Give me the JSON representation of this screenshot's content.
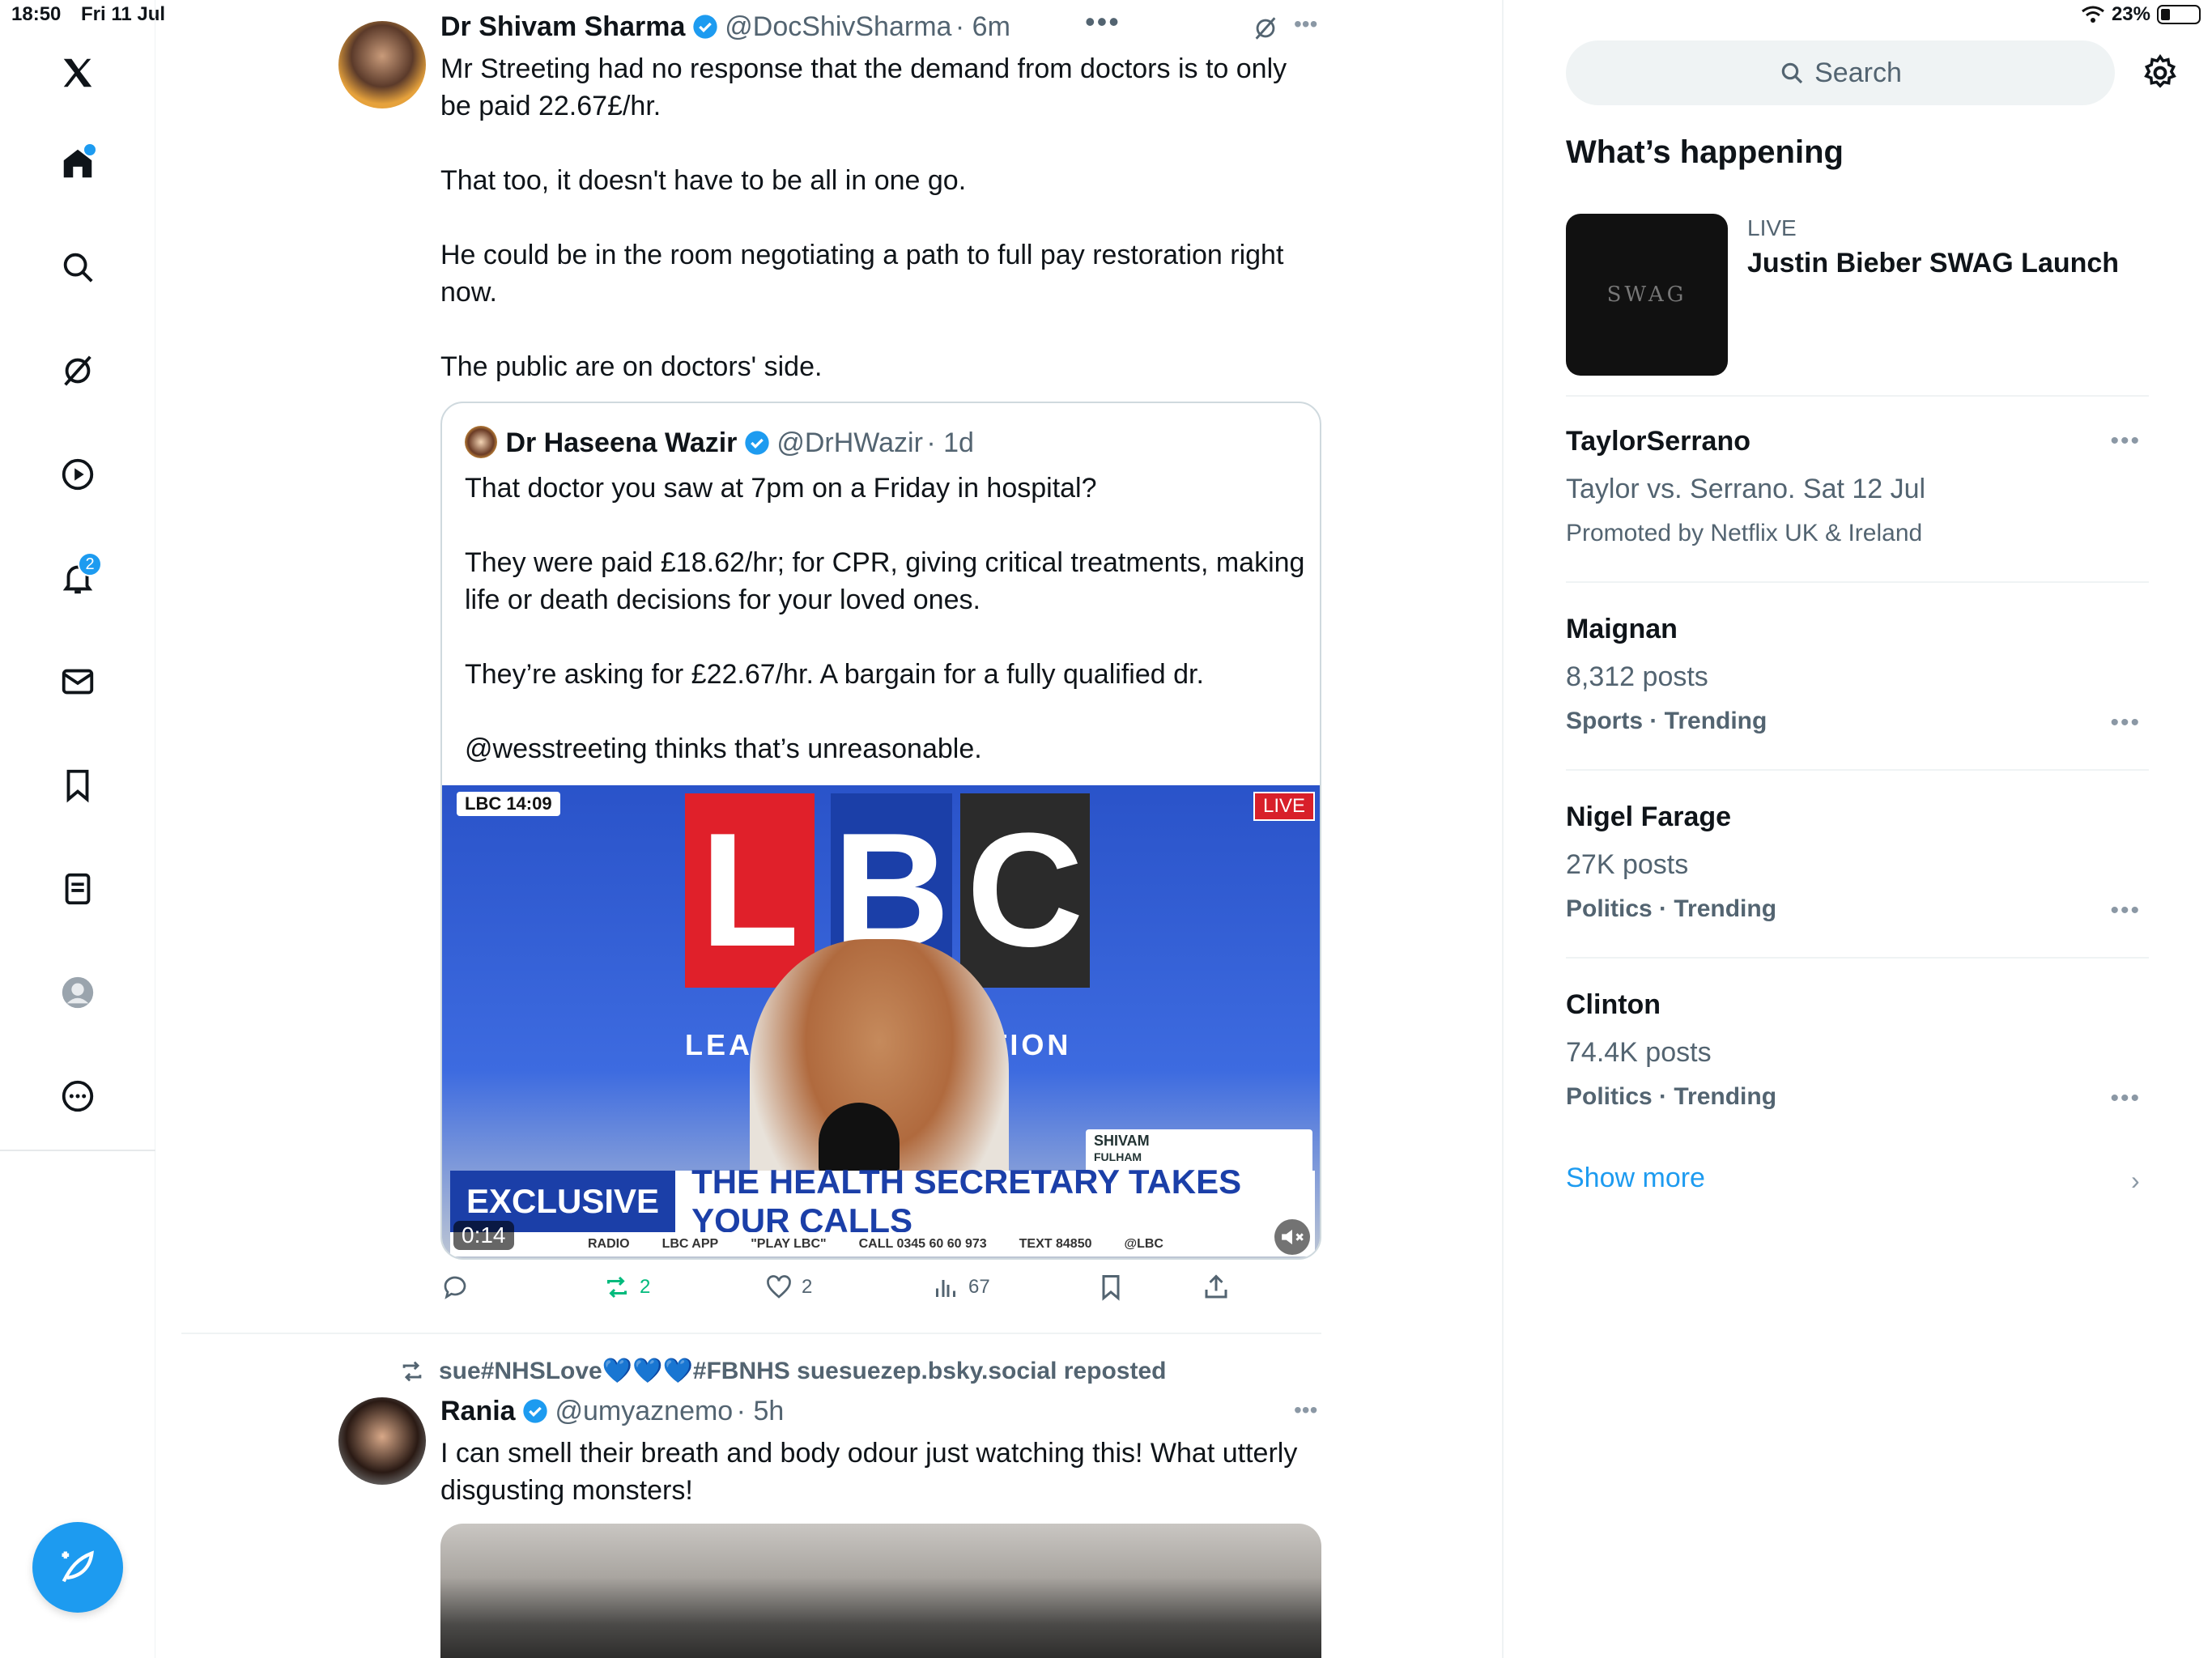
{
  "status": {
    "time": "18:50",
    "date": "Fri 11 Jul",
    "battery": "23%"
  },
  "nav": {
    "notifications_badge": "2"
  },
  "tweet1": {
    "name": "Dr Shivam Sharma",
    "handle": "@DocShivSharma",
    "time": "6m",
    "text": "Mr Streeting had no response that the demand from doctors is to only be paid 22.67£/hr.\n\nThat too, it doesn't have to be all in one go.\n\nHe could be in the room negotiating a path to full pay restoration right now.\n\nThe public are on doctors' side.",
    "quote": {
      "name": "Dr Haseena Wazir",
      "handle": "@DrHWazir",
      "time": "1d",
      "text": "That doctor you saw at 7pm on a Friday in hospital?\n\nThey were paid £18.62/hr; for CPR, giving critical treatments, making life or death decisions for your loved ones.\n\nThey’re asking for £22.67/hr. A bargain for a fully qualified dr.\n\n@wesstreeting thinks that’s unreasonable.",
      "video": {
        "channel_badge": "LBC 14:09",
        "live": "LIVE",
        "logo_letters": [
          "L",
          "B",
          "C"
        ],
        "tagline": "LEADING     NVERSATION",
        "caller_name": "SHIVAM",
        "caller_place": "FULHAM",
        "banner_left": "EXCLUSIVE",
        "banner_right": "THE HEALTH SECRETARY TAKES YOUR CALLS",
        "ticker": [
          "RADIO",
          "LBC APP",
          "\"PLAY LBC\"",
          "CALL 0345 60 60 973",
          "TEXT 84850",
          "@LBC"
        ],
        "duration": "0:14"
      }
    },
    "stats": {
      "retweets": "2",
      "likes": "2",
      "views": "67"
    }
  },
  "tweet2": {
    "reposted_by": "sue#NHSLove💙💙💙#FBNHS suesuezep.bsky.social reposted",
    "name": "Rania",
    "handle": "@umyaznemo",
    "time": "5h",
    "text": "I can smell their breath and body odour just watching this! What utterly disgusting monsters!"
  },
  "sidebar": {
    "search_placeholder": "Search",
    "heading": "What’s happening",
    "live_card": {
      "label": "LIVE",
      "title": "Justin Bieber SWAG Launch",
      "thumb_text": "SWAG"
    },
    "trends": [
      {
        "title": "TaylorSerrano",
        "sub": "Taylor vs. Serrano. Sat 12 Jul",
        "promo": "Promoted by Netflix UK & Ireland"
      },
      {
        "title": "Maignan",
        "sub": "8,312 posts",
        "cat": "Sports · Trending"
      },
      {
        "title": "Nigel Farage",
        "sub": "27K posts",
        "cat": "Politics · Trending"
      },
      {
        "title": "Clinton",
        "sub": "74.4K posts",
        "cat": "Politics · Trending"
      }
    ],
    "show_more": "Show more"
  },
  "colors": {
    "accent": "#1d9bf0",
    "text": "#0f1419",
    "muted": "#536471",
    "retweet": "#00ba7c"
  }
}
